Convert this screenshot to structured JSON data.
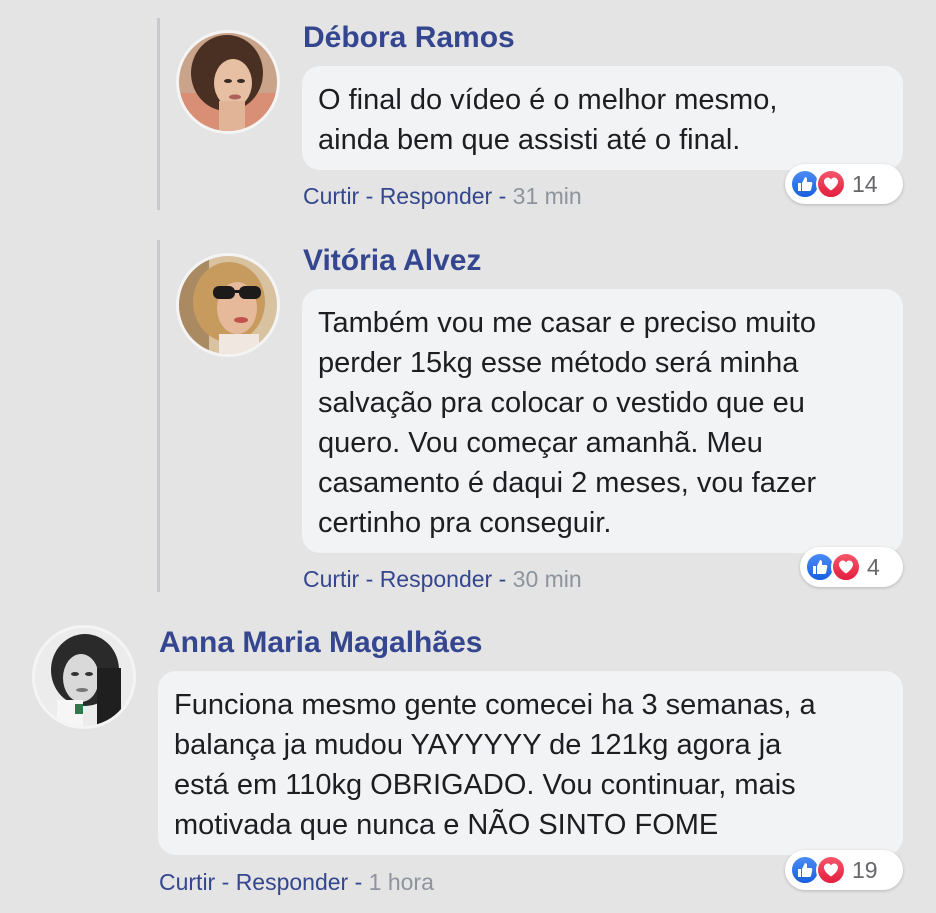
{
  "comments": [
    {
      "author": "Débora Ramos",
      "text": "O final do vídeo é o melhor mesmo,\nainda bem que assisti até o final.",
      "like_label": "Curtir",
      "separator": " - ",
      "reply_label": "Responder",
      "time": "31 min",
      "reaction_count": "14"
    },
    {
      "author": "Vitória Alvez",
      "text": "Também vou me casar e preciso muito\nperder 15kg esse método será minha\nsalvação pra colocar o vestido que eu\nquero. Vou começar amanhã. Meu\ncasamento é daqui 2 meses, vou fazer\ncertinho pra conseguir.",
      "like_label": "Curtir",
      "separator": " - ",
      "reply_label": "Responder",
      "time": "30 min",
      "reaction_count": "4"
    },
    {
      "author": "Anna Maria Magalhães",
      "text": "Funciona mesmo gente comecei ha 3 semanas, a\nbalança ja mudou YAYYYYY de 121kg agora ja\nestá em 110kg OBRIGADO. Vou continuar, mais\nmotivada que nunca e NÃO SINTO FOME",
      "like_label": "Curtir",
      "separator": " - ",
      "reply_label": "Responder",
      "time": "1 hora",
      "reaction_count": "19"
    }
  ],
  "colors": {
    "link": "#34468f",
    "background": "#e4e4e4",
    "bubble": "#f2f3f5",
    "like": "#1877f2",
    "love": "#e41e3f"
  },
  "icons": {
    "like": "thumbs-up-icon",
    "love": "heart-icon"
  }
}
